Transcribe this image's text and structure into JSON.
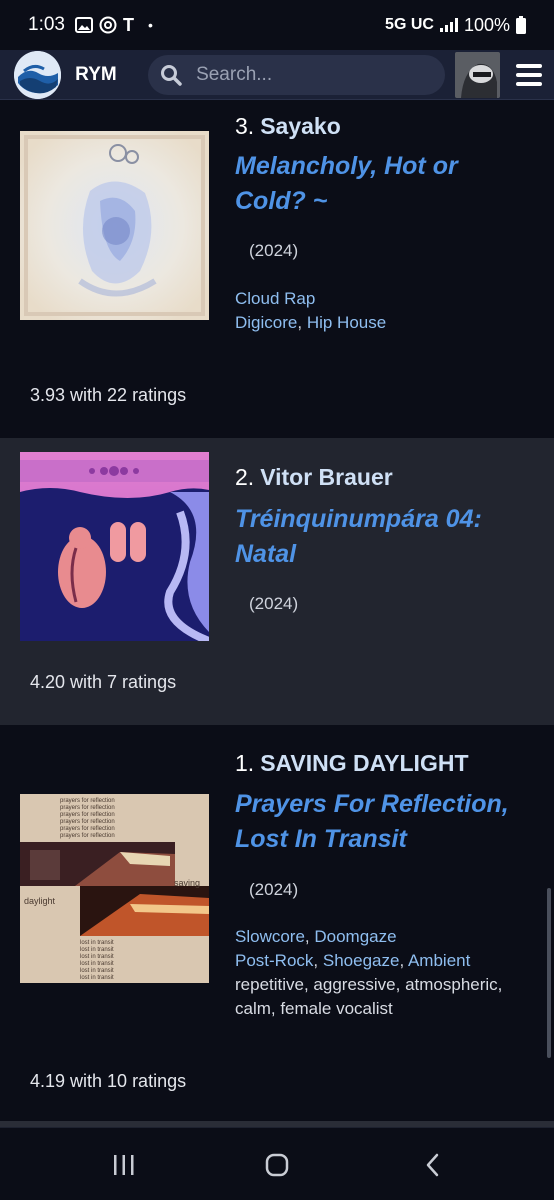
{
  "status_bar": {
    "time": "1:03",
    "notification_glyph": "T",
    "dot": "•",
    "network": "5G UC",
    "battery": "100%"
  },
  "header": {
    "brand": "RYM",
    "search_placeholder": "Search..."
  },
  "entries": [
    {
      "rank": "3.",
      "artist": "Sayako",
      "title": "Melancholy, Hot or Cold? ~",
      "year": "(2024)",
      "genres_line1": [
        "Cloud Rap"
      ],
      "genres_line2": [
        "Digicore",
        "Hip House"
      ],
      "rating": "3.93 with 22 ratings"
    },
    {
      "rank": "2.",
      "artist": "Vitor Brauer",
      "title": "Tréinquinumpára 04: Natal",
      "year": "(2024)",
      "rating": "4.20 with 7 ratings"
    },
    {
      "rank": "1.",
      "artist": "SAVING DAYLIGHT",
      "title": "Prayers For Reflection, Lost In Transit",
      "year": "(2024)",
      "genres_line1": [
        "Slowcore",
        "Doomgaze"
      ],
      "genres_line2": [
        "Post-Rock",
        "Shoegaze",
        "Ambient"
      ],
      "descriptors": "repetitive, aggressive, atmospheric, calm, female vocalist",
      "rating": "4.19 with 10 ratings",
      "cover_text": {
        "prayers": "prayers for reflection",
        "transit": "lost in transit",
        "word_left": "daylight",
        "word_right": "saving"
      }
    }
  ]
}
